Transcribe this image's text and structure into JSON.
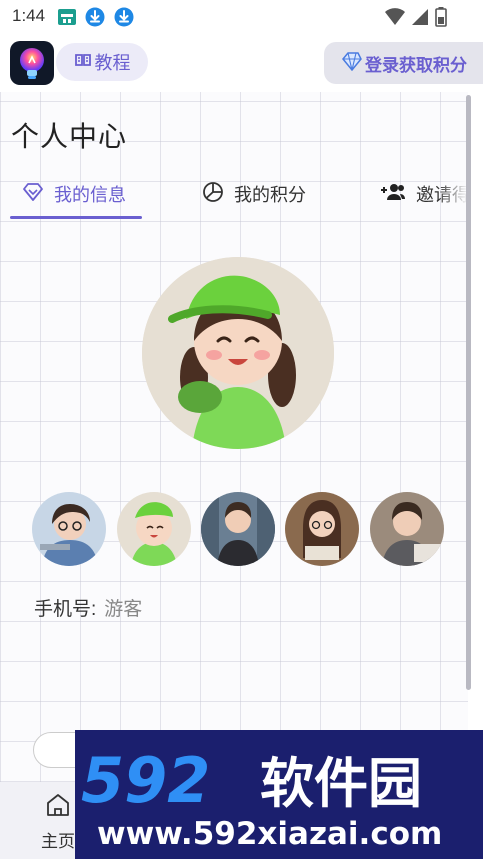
{
  "status_bar": {
    "time": "1:44",
    "icons": [
      "app-notification-icon",
      "download-icon",
      "download-icon"
    ],
    "right_icons": [
      "wifi-icon",
      "signal-icon",
      "battery-icon"
    ]
  },
  "top_bar": {
    "tutorial_label": "教程",
    "login_label": "登录获取积分",
    "accent": "#6a5fd0"
  },
  "page": {
    "title": "个人中心",
    "tabs": [
      {
        "label": "我的信息",
        "icon": "diamond-icon",
        "active": true
      },
      {
        "label": "我的积分",
        "icon": "pie-chart-icon",
        "active": false
      },
      {
        "label": "邀请得",
        "icon": "add-user-icon",
        "active": false
      }
    ],
    "profile": {
      "selected_avatar": 2,
      "avatar_options": 5
    },
    "phone_label": "手机号:",
    "phone_value": "游客"
  },
  "bottom_nav": {
    "home_label": "主页",
    "home_icon": "home-icon"
  },
  "watermark": {
    "brand": "592软件园",
    "url": "www.592xiazai.com"
  }
}
